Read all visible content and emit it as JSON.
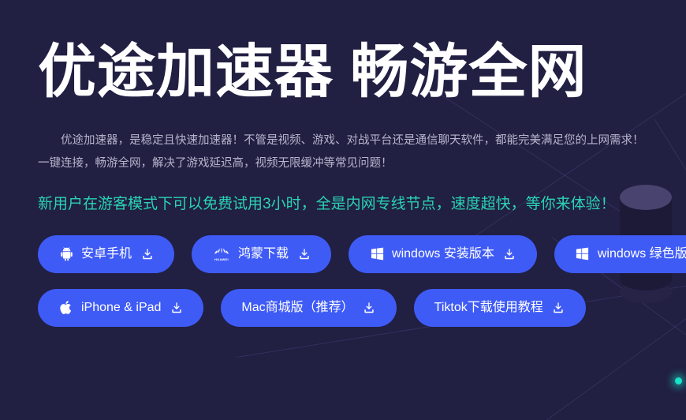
{
  "page": {
    "background_color": "#211f42",
    "accent_blue": "#3f5bf6",
    "accent_teal": "#2ad3b4",
    "title_color": "#ffffff",
    "body_text_color": "#b7b4cb"
  },
  "hero": {
    "title": "优途加速器 畅游全网",
    "description": "优途加速器，是稳定且快速加速器！不管是视频、游戏、对战平台还是通信聊天软件，都能完美满足您的上网需求！一键连接，畅游全网，解决了游戏延迟高，视频无限缓冲等常见问题！",
    "highlight": "新用户在游客模式下可以免费试用3小时，全是内网专线节点，速度超快，等你来体验！"
  },
  "download_buttons": {
    "row1": [
      {
        "label": "安卓手机",
        "lead_icon": "android-icon",
        "trailing_icon": "download-icon"
      },
      {
        "label": "鸿蒙下载",
        "lead_icon": "huawei-icon",
        "lead_icon_text": "HUAWEI",
        "trailing_icon": "download-icon"
      },
      {
        "label": "windows 安装版本",
        "lead_icon": "windows-icon",
        "trailing_icon": "download-icon"
      },
      {
        "label": "windows 绿色版本",
        "lead_icon": "windows-icon",
        "trailing_icon": "download-icon"
      }
    ],
    "row2": [
      {
        "label": "iPhone & iPad",
        "lead_icon": "apple-icon",
        "trailing_icon": "download-icon"
      },
      {
        "label": "Mac商城版（推荐）",
        "lead_icon": "none",
        "trailing_icon": "download-icon"
      },
      {
        "label": "Tiktok下载使用教程",
        "lead_icon": "none",
        "trailing_icon": "download-icon"
      }
    ]
  },
  "decoration": {
    "iso_cylinder_top_color": "#49436f",
    "iso_cylinder_band_color": "#1c8a81",
    "glow_dot_color": "#18e3c8",
    "diagonal_line_color": "#786ebe"
  }
}
